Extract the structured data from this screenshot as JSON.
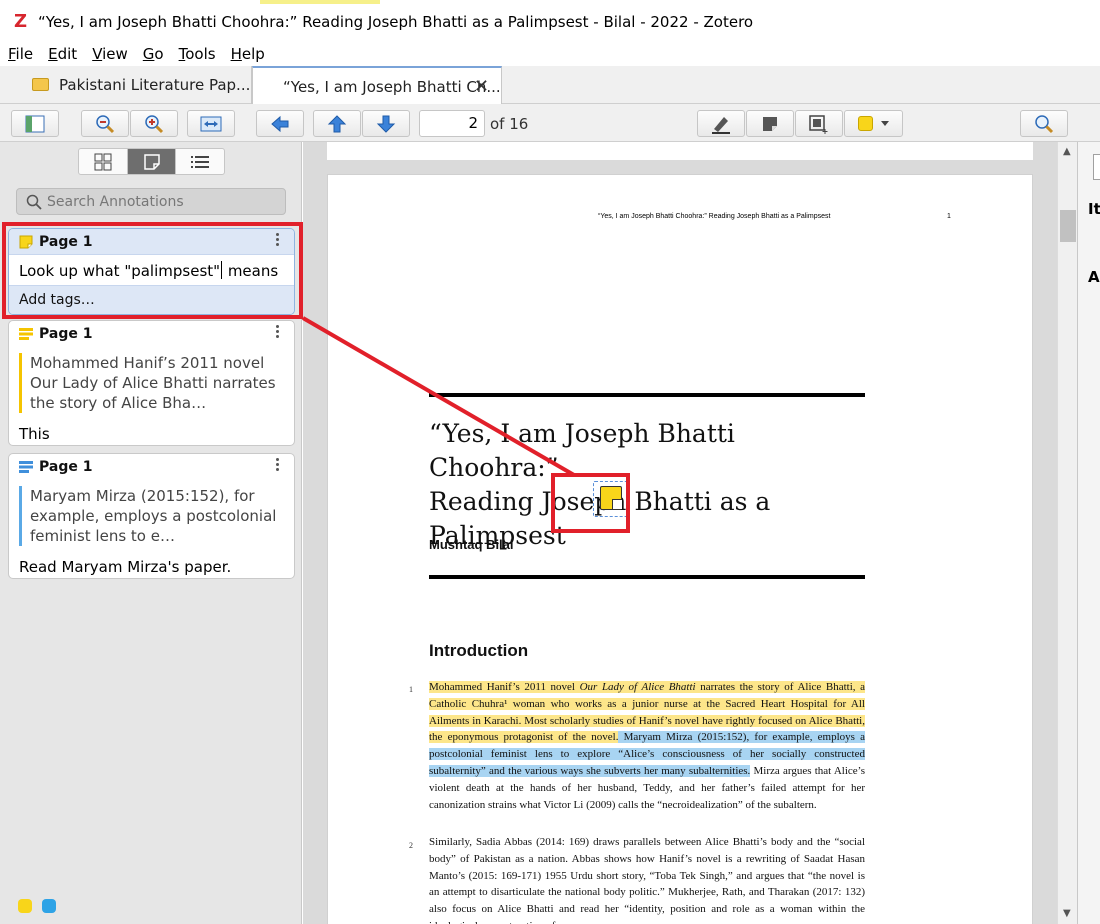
{
  "window": {
    "title": "“Yes, I am Joseph Bhatti Choohra:” Reading Joseph Bhatti as a Palimpsest - Bilal - 2022 - Zotero",
    "logo_letter": "Z"
  },
  "menu": [
    {
      "key": "F",
      "rest": "ile"
    },
    {
      "key": "E",
      "rest": "dit"
    },
    {
      "key": "V",
      "rest": "iew"
    },
    {
      "key": "G",
      "rest": "o"
    },
    {
      "key": "T",
      "rest": "ools"
    },
    {
      "key": "H",
      "rest": "elp"
    }
  ],
  "tabs": {
    "library": "Pakistani Literature Pap...",
    "document": "“Yes, I am Joseph Bhatti Ch...",
    "close_glyph": "✕"
  },
  "toolbar": {
    "page_number": "2",
    "page_total_text": "of 16",
    "highlight_color": "#f8d51a"
  },
  "sidebar": {
    "search_placeholder": "Search Annotations",
    "annotations": [
      {
        "type": "note",
        "page_label": "Page 1",
        "comment_before_caret": "Look up what \"palimpsest\"",
        "comment_after_caret": " means",
        "tags_placeholder": "Add tags…",
        "color": "#f8d51a"
      },
      {
        "type": "highlight",
        "page_label": "Page 1",
        "quote": "Mohammed Hanif’s 2011 novel Our Lady of Alice Bhatti narrates the story of Alice Bha…",
        "comment": "This",
        "color": "#f5c400"
      },
      {
        "type": "highlight",
        "page_label": "Page 1",
        "quote": "Maryam Mirza (2015:152), for example, employs a postcolonial feminist lens to e…",
        "comment": "Read Maryam Mirza's paper.",
        "color": "#5aa9e6"
      }
    ],
    "color_filters": [
      "#f8d51a",
      "#2ea3e6"
    ]
  },
  "document": {
    "running_head": "“Yes, I am Joseph Bhatti Choohra:” Reading Joseph Bhatti as a Palimpsest",
    "running_page": "1",
    "title_lines": [
      "“Yes, I am Joseph Bhatti Choohra:”",
      "Reading Joseph Bhatti as a",
      "Palimpsest"
    ],
    "author": "Mushtaq Bilal",
    "section": "Introduction",
    "para1_num": "1",
    "para1": {
      "y1": "Mohammed Hanif’s 2011 novel ",
      "y1i": "Our Lady of Alice Bhatti",
      "y2": " narrates the story of Alice Bhatti, a Catholic Chuhra¹ woman who works as a junior nurse at the Sacred Heart Hospital for All Ailments in Karachi. Most scholarly studies of Hanif’s novel have rightly focused on Alice Bhatti, the eponymous protagonist of the novel.",
      "b1": " Maryam Mirza (2015:152), for example, employs a postcolonial feminist lens to explore “Alice’s consciousness of her socially constructed subalternity” and the various ways she subverts her many subalternities.",
      "plain": " Mirza argues that Alice’s violent death at the hands of her husband, Teddy, and her father’s failed attempt for her canonization strains what Victor Li (2009) calls the “necroidealization” of the subaltern."
    },
    "para2_num": "2",
    "para2": "Similarly, Sadia Abbas (2014: 169) draws parallels between Alice Bhatti’s body and the “social body” of Pakistan as a nation. Abbas shows how Hanif’s novel is a rewriting of Saadat Hasan Manto’s (2015: 169-171) 1955 Urdu short story, “Toba Tek Singh,” and argues that “the novel is an attempt to disarticulate the national body politic.” Mukherjee, Rath, and Tharakan (2017: 132) also focus on Alice Bhatti and read her “identity, position and role as a woman within the ideological reconstruction of"
  },
  "rightpane": {
    "label1": "Ite",
    "label2": "Al"
  },
  "colors": {
    "callout_red": "#e1202a",
    "highlight_yellow": "#fde68a",
    "highlight_blue": "#a8d4f2"
  }
}
